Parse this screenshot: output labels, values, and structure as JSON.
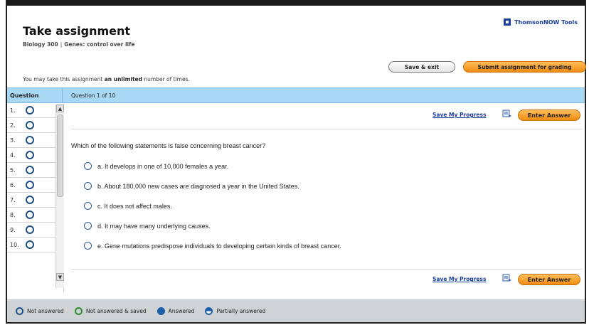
{
  "header": {
    "title": "Take assignment",
    "course": "Biology 300",
    "topic": "Genes: control over life",
    "tools_label": "ThomsonNOW Tools",
    "notice_prefix": "You may take this assignment",
    "notice_bold": "an unlimited",
    "notice_suffix": "number of times."
  },
  "buttons": {
    "save_exit": "Save & exit",
    "submit": "Submit assignment for grading"
  },
  "question_header": {
    "column_label": "Question",
    "current": "Question 1 of 10"
  },
  "questions": [
    "1.",
    "2.",
    "3.",
    "4.",
    "5.",
    "6.",
    "7.",
    "8.",
    "9.",
    "10."
  ],
  "actions": {
    "save_progress": "Save My Progress",
    "enter_answer": "Enter Answer"
  },
  "question": {
    "text": "Which of the following statements is false concerning breast cancer?",
    "options": [
      "a. It develops in one of 10,000 females a year.",
      "b. About 180,000 new cases are diagnosed a year in the United States.",
      "c. It does not affect males.",
      "d. It may have many underlying causes.",
      "e. Gene mutations predispose individuals to developing certain kinds of breast cancer."
    ]
  },
  "legend": {
    "not_answered": "Not answered",
    "not_answered_saved": "Not answered & saved",
    "answered": "Answered",
    "partially_answered": "Partially answered"
  },
  "colors": {
    "accent_orange": "#f08c12",
    "header_blue": "#a9d8f4",
    "link_blue": "#1a3e9a",
    "legend_bg": "#cfd3d6"
  }
}
